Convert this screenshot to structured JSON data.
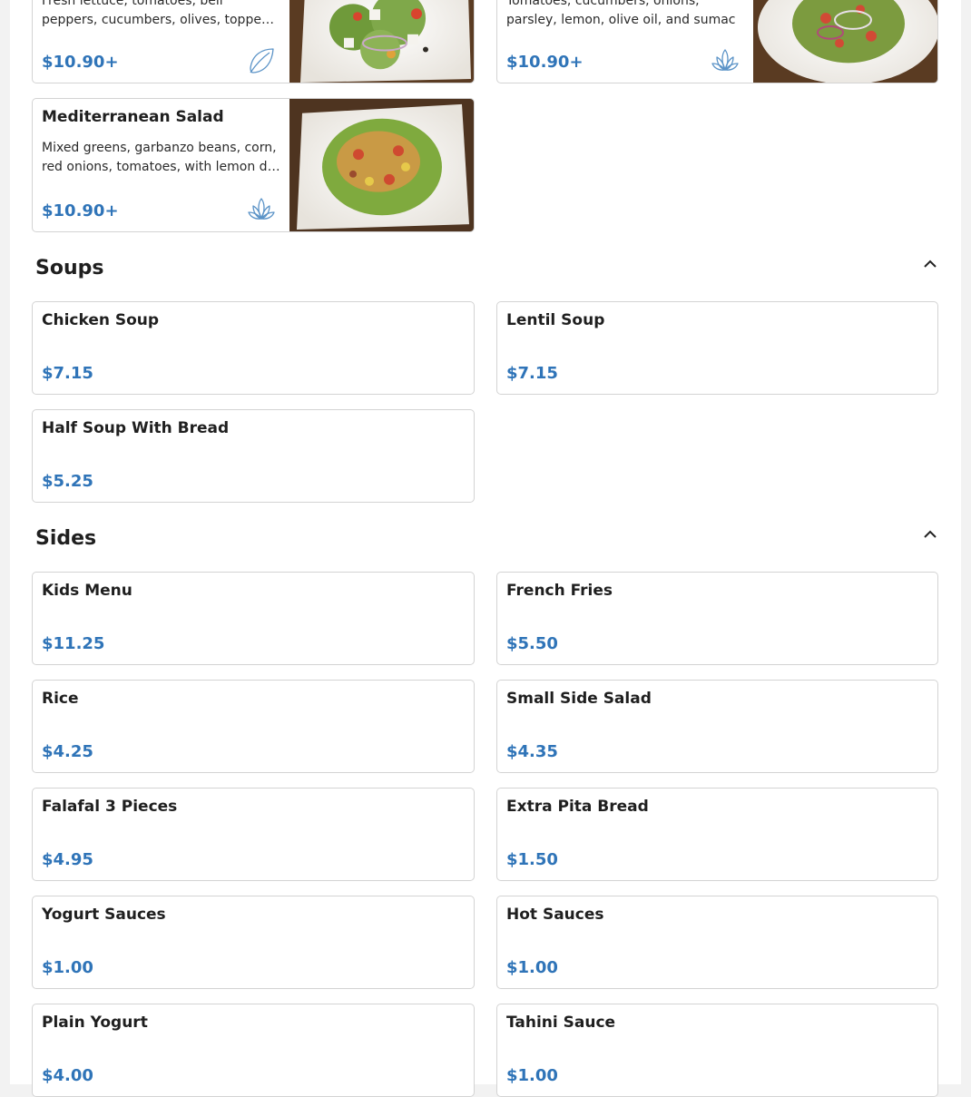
{
  "salads": {
    "items": [
      {
        "name": "",
        "desc_lines": [
          "Fresh lettuce, tomatoes, bell",
          "peppers, cucumbers, olives, topped with feta"
        ],
        "price": "$10.90+",
        "diet_icon": "leaf-icon"
      },
      {
        "name": "",
        "desc_lines": [
          "Tomatoes, cucumbers, onions,",
          "parsley, lemon, olive oil, and sumac"
        ],
        "price": "$10.90+",
        "diet_icon": "lotus-icon"
      },
      {
        "name": "Mediterranean Salad",
        "desc_lines": [
          "Mixed greens, garbanzo beans, corn,",
          "red onions, tomatoes, with lemon dressing"
        ],
        "price": "$10.90+",
        "diet_icon": "lotus-icon"
      }
    ]
  },
  "soups": {
    "title": "Soups",
    "collapse_icon": "chevron-up-icon",
    "items": [
      {
        "name": "Chicken Soup",
        "price": "$7.15"
      },
      {
        "name": "Lentil Soup",
        "price": "$7.15"
      },
      {
        "name": "Half Soup With Bread",
        "price": "$5.25"
      }
    ]
  },
  "sides": {
    "title": "Sides",
    "collapse_icon": "chevron-up-icon",
    "items": [
      {
        "name": "Kids Menu",
        "price": "$11.25"
      },
      {
        "name": "French Fries",
        "price": "$5.50"
      },
      {
        "name": "Rice",
        "price": "$4.25"
      },
      {
        "name": "Small Side Salad",
        "price": "$4.35"
      },
      {
        "name": "Falafal 3 Pieces",
        "price": "$4.95"
      },
      {
        "name": "Extra Pita Bread",
        "price": "$1.50"
      },
      {
        "name": "Yogurt Sauces",
        "price": "$1.00"
      },
      {
        "name": "Hot Sauces",
        "price": "$1.00"
      },
      {
        "name": "Plain Yogurt",
        "price": "$4.00"
      },
      {
        "name": "Tahini Sauce",
        "price": "$1.00"
      }
    ]
  },
  "colors": {
    "price": "#2f74b8",
    "icon_stroke": "#5b93c7",
    "border": "#d3d3d3",
    "page_background": "#f2f2f2"
  }
}
